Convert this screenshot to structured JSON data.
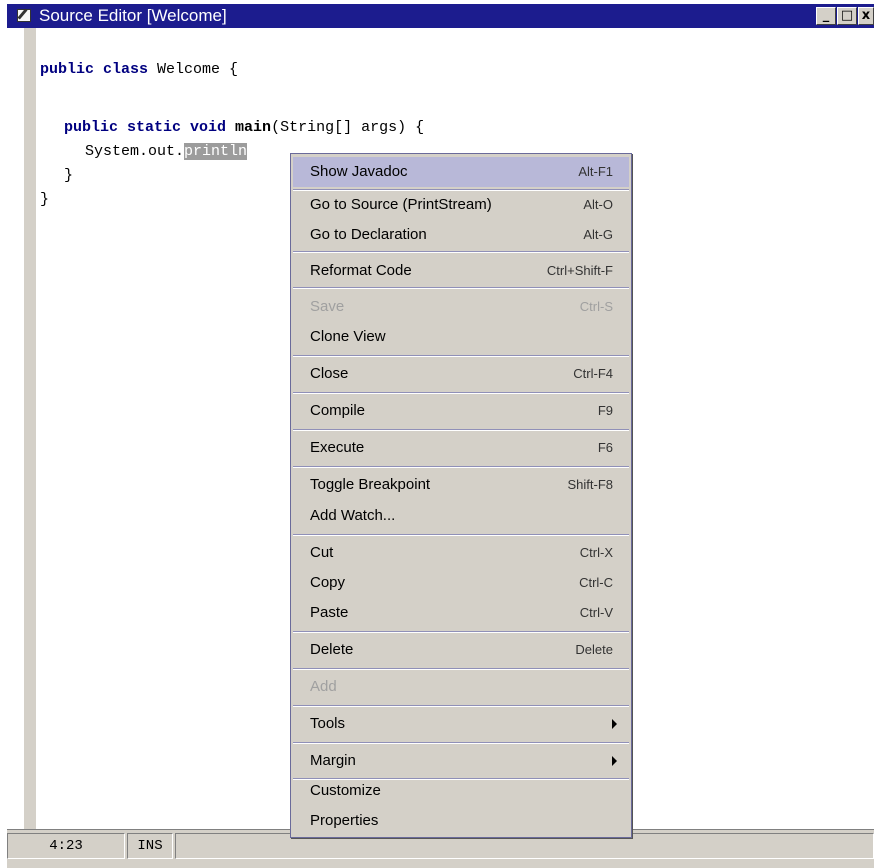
{
  "window": {
    "title": "Source Editor [Welcome]",
    "controls": {
      "minimize": "_",
      "maximize": "□",
      "close": "x"
    }
  },
  "editor": {
    "lines": [
      {
        "t1": "public class",
        "t2": " Welcome {"
      },
      {
        "t1": "public static void",
        "t2": " ",
        "t3": "main",
        "t4": "(String[] args) {"
      },
      {
        "t1": "System.out.",
        "t2": "println"
      },
      {
        "t1": "}"
      },
      {
        "t1": "}"
      }
    ]
  },
  "context_menu": {
    "items": [
      {
        "label": "Show Javadoc",
        "shortcut": "Alt-F1",
        "highlighted": true
      },
      {
        "label": "Go to Source (PrintStream)",
        "shortcut": "Alt-O"
      },
      {
        "label": "Go to Declaration",
        "shortcut": "Alt-G"
      },
      {
        "label": "Reformat Code",
        "shortcut": "Ctrl+Shift-F"
      },
      {
        "label": "Save",
        "shortcut": "Ctrl-S",
        "disabled": true
      },
      {
        "label": "Clone View",
        "shortcut": ""
      },
      {
        "label": "Close",
        "shortcut": "Ctrl-F4"
      },
      {
        "label": "Compile",
        "shortcut": "F9"
      },
      {
        "label": "Execute",
        "shortcut": "F6"
      },
      {
        "label": "Toggle Breakpoint",
        "shortcut": "Shift-F8"
      },
      {
        "label": "Add Watch...",
        "shortcut": ""
      },
      {
        "label": "Cut",
        "shortcut": "Ctrl-X"
      },
      {
        "label": "Copy",
        "shortcut": "Ctrl-C"
      },
      {
        "label": "Paste",
        "shortcut": "Ctrl-V"
      },
      {
        "label": "Delete",
        "shortcut": "Delete"
      },
      {
        "label": "Add",
        "shortcut": "",
        "disabled": true
      },
      {
        "label": "Tools",
        "submenu": true
      },
      {
        "label": "Margin",
        "submenu": true
      },
      {
        "label": "Customize",
        "shortcut": ""
      },
      {
        "label": "Properties",
        "shortcut": ""
      }
    ]
  },
  "status": {
    "position": "4:23",
    "mode": "INS"
  },
  "colors": {
    "title_bar": "#1c1c8e",
    "keyword": "#000080",
    "menu_bg": "#d4d0c8",
    "menu_highlight": "#b8b8d8"
  }
}
